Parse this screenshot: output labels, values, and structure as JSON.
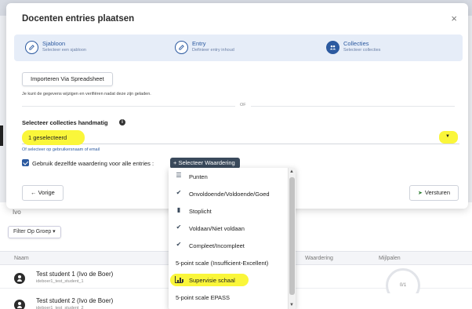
{
  "modal": {
    "title": "Docenten entries plaatsen",
    "close_icon": "×"
  },
  "stepper": {
    "steps": [
      {
        "title": "Sjabloon",
        "subtitle": "Selecteer een sjabloon",
        "icon": "edit-icon",
        "state": "done"
      },
      {
        "title": "Entry",
        "subtitle": "Definieer entry inhoud",
        "icon": "edit-icon",
        "state": "done"
      },
      {
        "title": "Collecties",
        "subtitle": "Selecteer collecties",
        "icon": "group-icon",
        "state": "active"
      }
    ],
    "accent": "#2c5aa0",
    "background": "#e6edf8"
  },
  "import": {
    "button_label": "Importeren Via Spreadsheet",
    "hint": "Je kunt de gegevens wijzigen en verifiëren nadat deze zijn geladen."
  },
  "divider_label": "OF",
  "collections": {
    "label": "Selecteer collecties handmatig",
    "info_icon": "i",
    "selected_value": "1 geselecteerd",
    "alt_link": "Of selecteer op gebruikersnaam of email"
  },
  "rating": {
    "checkbox_label": "Gebruik dezelfde waardering voor alle entries :",
    "checkbox_checked": true,
    "button_label": "+ Selecteer Waardering"
  },
  "footer": {
    "prev_label": "← Vorige",
    "send_label": "Versturen"
  },
  "dropdown": {
    "items": [
      {
        "label": "Punten",
        "icon": "list-icon",
        "glyph": "☰"
      },
      {
        "label": "Onvoldoende/Voldoende/Goed",
        "icon": "check-icon",
        "glyph": "✔"
      },
      {
        "label": "Stoplicht",
        "icon": "traffic-light-icon",
        "glyph": "▮"
      },
      {
        "label": "Voldaan/Niet voldaan",
        "icon": "check-icon",
        "glyph": "✔"
      },
      {
        "label": "Compleet/Incompleet",
        "icon": "check-icon",
        "glyph": "✔"
      },
      {
        "label": "5-point scale (Insufficient-Excellent)",
        "icon": "",
        "glyph": ""
      },
      {
        "label": "Supervisie schaal",
        "icon": "bar-chart-icon",
        "glyph": "",
        "highlighted": true
      },
      {
        "label": "5-point scale EPASS",
        "icon": "",
        "glyph": ""
      }
    ],
    "highlight_color": "#faf63a"
  },
  "background_page": {
    "user_label": "Ivo",
    "filter_label": "Filter Op Groep ▾",
    "columns": [
      "Naam",
      "Waardering",
      "Mijlpalen"
    ],
    "rows": [
      {
        "name": "Test student 1 (Ivo de Boer)",
        "username": "ideboer1_test_student_1"
      },
      {
        "name": "Test student 2 (Ivo de Boer)",
        "username": "ideboer1_test_student_2"
      }
    ],
    "milestone_value": "0/1"
  }
}
